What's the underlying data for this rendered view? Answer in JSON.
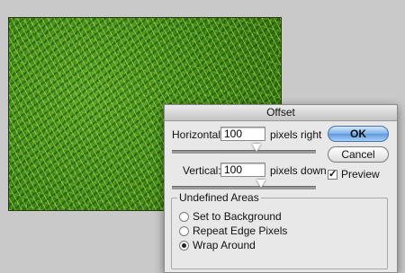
{
  "dialog": {
    "title": "Offset",
    "horizontal_label": "Horizontal:",
    "horizontal_value": "100",
    "horizontal_unit": "pixels right",
    "vertical_label": "Vertical:",
    "vertical_value": "100",
    "vertical_unit": "pixels down",
    "ok_label": "OK",
    "cancel_label": "Cancel",
    "preview_label": "Preview",
    "preview_checked": true,
    "undefined_areas": {
      "legend": "Undefined Areas",
      "options": [
        "Set to Background",
        "Repeat Edge Pixels",
        "Wrap Around"
      ],
      "selected": "Wrap Around"
    }
  },
  "canvas": {
    "description_icon": "grass-texture-image"
  }
}
